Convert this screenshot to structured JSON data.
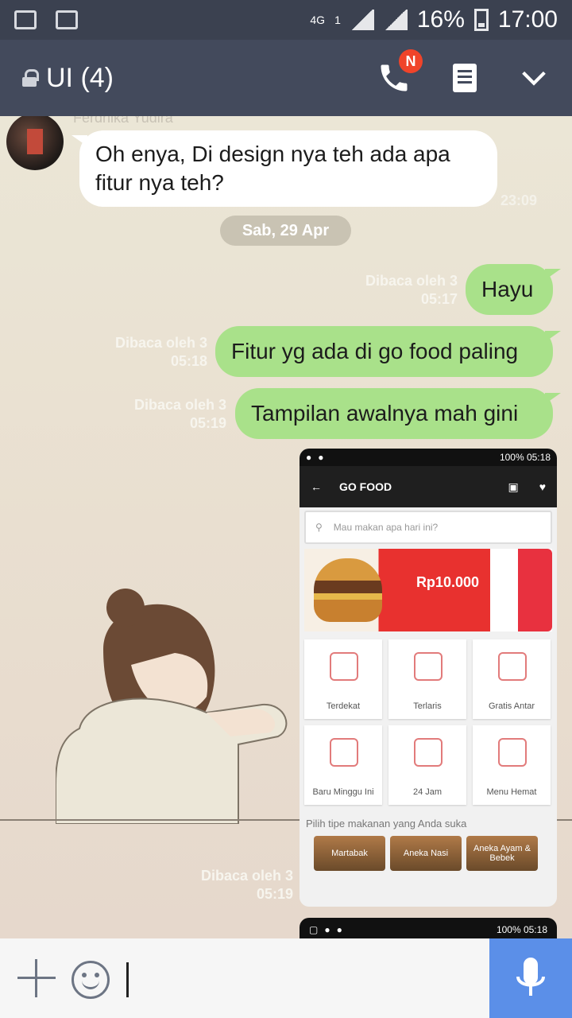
{
  "status_bar": {
    "network": "4G",
    "sim": "1",
    "battery": "16%",
    "time": "17:00",
    "icons": [
      "mail-icon",
      "image-icon",
      "signal-icon",
      "battery-icon"
    ]
  },
  "header": {
    "title": "UI (4)",
    "call_badge": "N",
    "icons": [
      "lock-icon",
      "phone-icon",
      "notes-icon",
      "chevron-down-icon"
    ]
  },
  "chat": {
    "sender_name": "Ferdnika Yudira",
    "messages": [
      {
        "side": "in",
        "text": "Oh enya, Di design nya teh ada apa fitur nya teh?",
        "time": "23:09"
      },
      {
        "side": "out",
        "text": "Hayu",
        "read": "Dibaca oleh 3",
        "time": "05:17"
      },
      {
        "side": "out",
        "text": "Fitur yg ada di go food paling",
        "read": "Dibaca oleh 3",
        "time": "05:18"
      },
      {
        "side": "out",
        "text": "Tampilan awalnya mah gini",
        "read": "Dibaca oleh 3",
        "time": "05:19"
      }
    ],
    "date_separator": "Sab, 29 Apr",
    "image_meta": {
      "read": "Dibaca oleh 3",
      "time": "05:19"
    }
  },
  "shared_screenshot": {
    "status_right": "100% 05:18",
    "brand": "GO FOOD",
    "search_placeholder": "Mau makan apa hari ini?",
    "banner_price": "Rp10.000",
    "tiles": [
      "Terdekat",
      "Terlaris",
      "Gratis Antar",
      "Baru Minggu Ini",
      "24 Jam",
      "Menu Hemat"
    ],
    "caption": "Pilih tipe makanan yang Anda suka",
    "categories": [
      "Martabak",
      "Aneka Nasi",
      "Aneka Ayam & Bebek"
    ]
  },
  "shared_screenshot_2": {
    "status_right": "100% 05:18"
  },
  "input_bar": {
    "placeholder": ""
  },
  "colors": {
    "accent": "#5b8fe8",
    "bubble_out": "#a9e18a",
    "header": "#434a5c"
  }
}
